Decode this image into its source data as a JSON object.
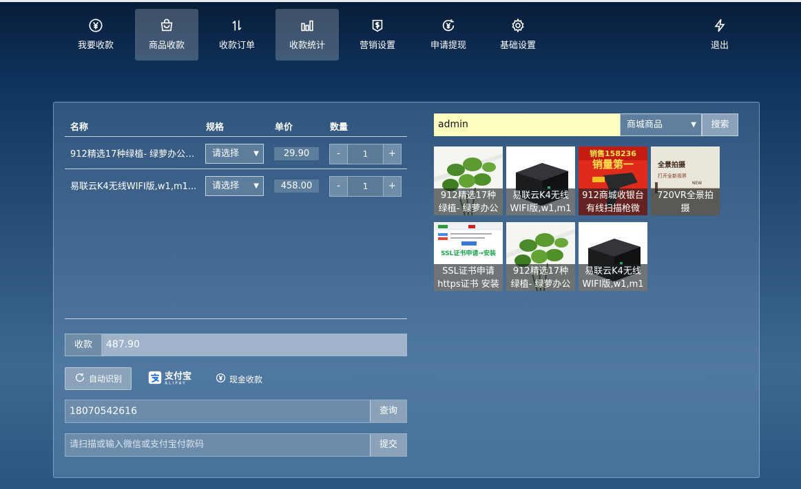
{
  "nav": [
    {
      "label": "我要收款",
      "icon": "yuan-circle-icon",
      "active": false
    },
    {
      "label": "商品收款",
      "icon": "shopping-bag-icon",
      "active": true
    },
    {
      "label": "收款订单",
      "icon": "sort-arrows-icon",
      "active": false
    },
    {
      "label": "收款统计",
      "icon": "bar-chart-icon",
      "active": true
    },
    {
      "label": "营销设置",
      "icon": "tag-dollar-icon",
      "active": false
    },
    {
      "label": "申请提现",
      "icon": "withdraw-refresh-icon",
      "active": false
    },
    {
      "label": "基础设置",
      "icon": "gear-icon",
      "active": false
    },
    {
      "label": "退出",
      "icon": "lightning-icon",
      "active": false
    }
  ],
  "cart": {
    "headers": {
      "name": "名称",
      "spec": "规格",
      "price": "单价",
      "qty": "数量"
    },
    "rows": [
      {
        "name": "912精选17种绿植- 绿萝办公室...",
        "spec": "请选择",
        "price": "29.90",
        "qty": "1"
      },
      {
        "name": "易联云K4无线WIFI版,w1,m1...",
        "spec": "请选择",
        "price": "458.00",
        "qty": "1"
      }
    ],
    "minus": "-",
    "plus": "+",
    "caret": "▼"
  },
  "total": {
    "label": "收款",
    "value": "487.90"
  },
  "pay_methods": {
    "auto": "自动识别",
    "alipay": "支付宝",
    "alipay_en": "ALIPAY",
    "cash": "现金收款"
  },
  "phone": {
    "value": "18070542616",
    "button": "查询"
  },
  "paycode": {
    "placeholder": "请扫描或输入微信或支付宝付款码",
    "button": "提交"
  },
  "search": {
    "value": "admin",
    "scope": "商城商品",
    "caret": "▼",
    "button": "搜索"
  },
  "products": [
    {
      "title_line1": "912精选17种",
      "title_line2": "绿植- 绿萝办公",
      "image": "plant"
    },
    {
      "title_line1": "易联云K4无线",
      "title_line2": "WIFI版,w1,m1",
      "image": "printer"
    },
    {
      "title_line1": "912商城收银台",
      "title_line2": "有线扫描枪微",
      "image": "scanner",
      "overlay_top": "销售158236",
      "overlay_big": "销量第一"
    },
    {
      "title_line1": "720VR全景拍",
      "title_line2": "摄",
      "image": "vr",
      "overlay_top": "全景拍摄",
      "overlay_big": "打开全新视界",
      "overlay_sub": "NEW"
    },
    {
      "title_line1": "SSL证书申请",
      "title_line2": "https证书 安装",
      "image": "ssl",
      "overlay_top": "SSL证书申请→安装"
    },
    {
      "title_line1": "912精选17种",
      "title_line2": "绿植- 绿萝办公",
      "image": "plant"
    },
    {
      "title_line1": "易联云K4无线",
      "title_line2": "WIFI版,w1,m1",
      "image": "printer"
    }
  ]
}
